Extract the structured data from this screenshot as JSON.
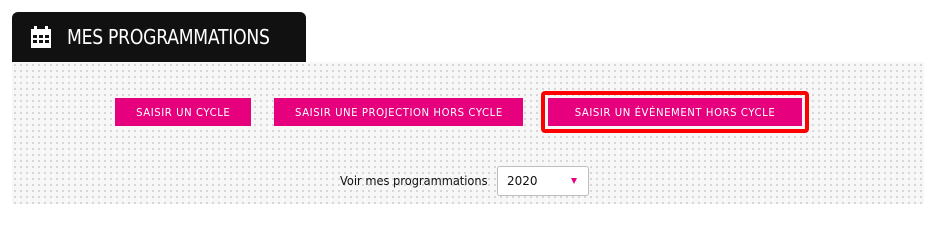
{
  "header": {
    "title": "MES PROGRAMMATIONS",
    "icon": "calendar-icon"
  },
  "actions": {
    "cycle_label": "SAISIR UN CYCLE",
    "projection_label": "SAISIR UNE PROJECTION HORS CYCLE",
    "event_label": "SAISIR UN ÉVÉNEMENT HORS CYCLE"
  },
  "filter": {
    "label": "Voir mes programmations",
    "selected_year": "2020"
  },
  "colors": {
    "accent": "#e6007e",
    "header_bg": "#111111",
    "highlight": "#ff0000"
  }
}
